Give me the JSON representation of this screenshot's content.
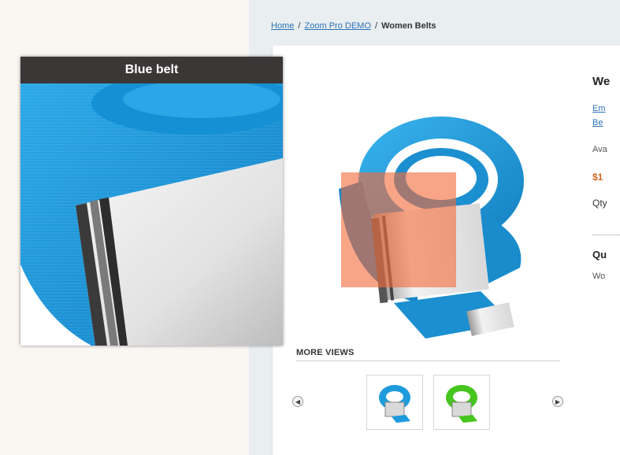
{
  "breadcrumb": {
    "home": "Home",
    "sep1": "/",
    "demo": "Zoom Pro DEMO",
    "sep2": "/",
    "current": "Women Belts"
  },
  "zoom": {
    "title": "Blue belt"
  },
  "product_info": {
    "title_fragment": "We",
    "link1_fragment": "Em",
    "link2_fragment": "Be",
    "availability_fragment": "Ava",
    "price_fragment": "$1",
    "qty_fragment": "Qty",
    "quick_overview_fragment": "Qu",
    "description_fragment": "Wo"
  },
  "more_views": {
    "label": "MORE VIEWS",
    "prev_symbol": "◀",
    "next_symbol": "▶",
    "thumbnails": [
      {
        "alt": "blue belt thumbnail",
        "color": "#1e9bdc"
      },
      {
        "alt": "green belt thumbnail",
        "color": "#46c51e"
      }
    ]
  },
  "colors": {
    "belt_blue": "#1e9bdc",
    "belt_green": "#46c51e",
    "lens_orange": "#f46c3c",
    "zoom_title_bg": "#3c3737",
    "link_blue": "#2b72b8"
  }
}
